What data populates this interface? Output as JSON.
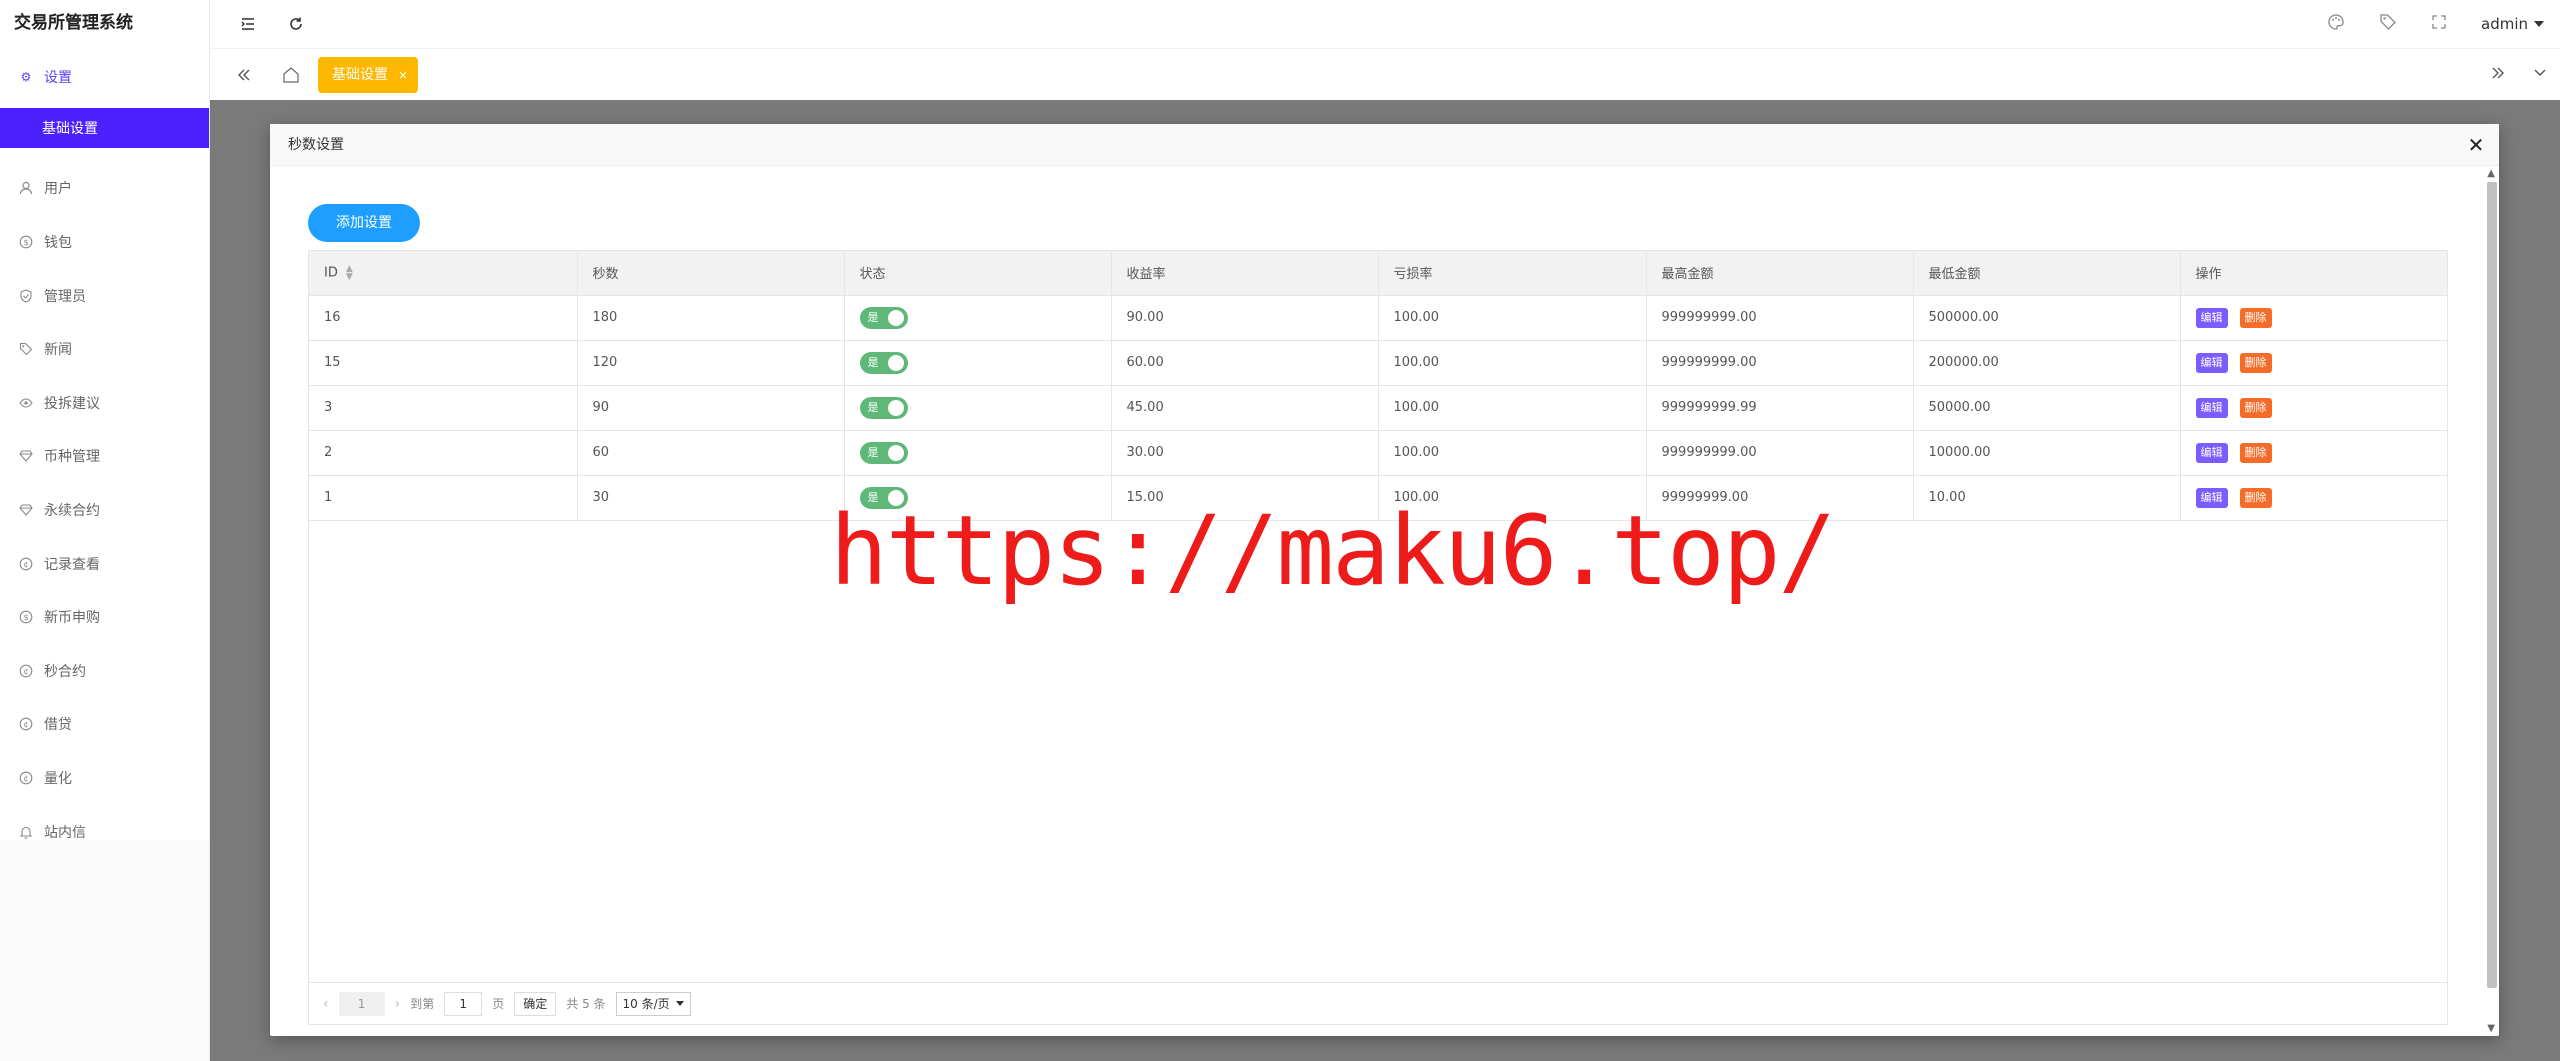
{
  "app": {
    "title": "交易所管理系统"
  },
  "header": {
    "user": "admin"
  },
  "sidebar": {
    "items": [
      {
        "label": "设置",
        "icon": "gear-icon",
        "active_parent": true
      },
      {
        "label": "基础设置",
        "icon": "",
        "active_child": true
      },
      {
        "label": "用户",
        "icon": "user-icon"
      },
      {
        "label": "钱包",
        "icon": "wallet-icon"
      },
      {
        "label": "管理员",
        "icon": "shield-icon"
      },
      {
        "label": "新闻",
        "icon": "tag-icon"
      },
      {
        "label": "投拆建议",
        "icon": "eye-icon"
      },
      {
        "label": "币种管理",
        "icon": "diamond-icon"
      },
      {
        "label": "永续合约",
        "icon": "diamond-icon"
      },
      {
        "label": "记录查看",
        "icon": "coin-icon"
      },
      {
        "label": "新币申购",
        "icon": "dollar-icon"
      },
      {
        "label": "秒合约",
        "icon": "coin-icon"
      },
      {
        "label": "借贷",
        "icon": "coin-icon"
      },
      {
        "label": "量化",
        "icon": "coin-icon"
      },
      {
        "label": "站内信",
        "icon": "bell-icon"
      }
    ]
  },
  "tabs": {
    "active": "基础设置"
  },
  "modal": {
    "title": "秒数设置",
    "add_button": "添加设置",
    "columns": [
      "ID",
      "秒数",
      "状态",
      "收益率",
      "亏损率",
      "最高金额",
      "最低金额",
      "操作"
    ],
    "switch_label": "是",
    "edit_label": "编辑",
    "delete_label": "删除",
    "rows": [
      {
        "id": "16",
        "seconds": "180",
        "yield": "90.00",
        "loss": "100.00",
        "max": "999999999.00",
        "min": "500000.00"
      },
      {
        "id": "15",
        "seconds": "120",
        "yield": "60.00",
        "loss": "100.00",
        "max": "999999999.00",
        "min": "200000.00"
      },
      {
        "id": "3",
        "seconds": "90",
        "yield": "45.00",
        "loss": "100.00",
        "max": "999999999.99",
        "min": "50000.00"
      },
      {
        "id": "2",
        "seconds": "60",
        "yield": "30.00",
        "loss": "100.00",
        "max": "999999999.00",
        "min": "10000.00"
      },
      {
        "id": "1",
        "seconds": "30",
        "yield": "15.00",
        "loss": "100.00",
        "max": "99999999.00",
        "min": "10.00"
      }
    ],
    "pager": {
      "current": "1",
      "goto_label": "到第",
      "goto_value": "1",
      "page_unit": "页",
      "confirm": "确定",
      "total": "共 5 条",
      "page_size": "10 条/页"
    }
  },
  "watermark": "https://maku6.top/",
  "colors": {
    "accent_purple": "#4b22ff",
    "tab_yellow": "#ffb800",
    "primary_blue": "#1e9fff",
    "switch_green": "#5fb878",
    "edit_purple": "#7a5cff",
    "delete_orange": "#f46c27",
    "watermark_red": "#ee1b1b"
  }
}
